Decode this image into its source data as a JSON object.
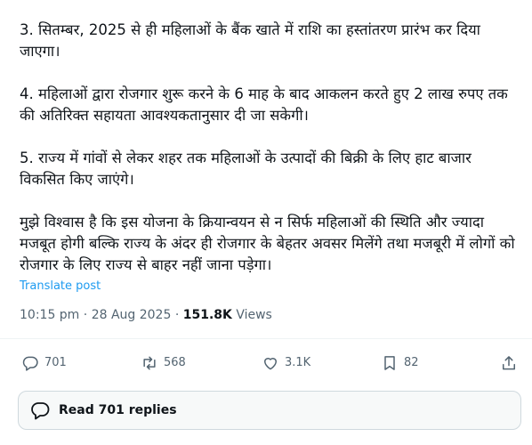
{
  "post": {
    "paragraphs": [
      "3. सितम्बर, 2025 से ही महिलाओं के बैंक खाते में राशि का हस्तांतरण प्रारंभ कर दिया जाएगा।",
      "4. महिलाओं द्वारा रोजगार शुरू करने के 6 माह के बाद आकलन करते हुए 2 लाख रुपए तक की अतिरिक्त सहायता आवश्यकतानुसार दी जा सकेगी।",
      "5. राज्य में गांवों से लेकर शहर तक महिलाओं के उत्पादों की बिक्री के लिए हाट बाजार विकसित किए जाएंगे।",
      "मुझे विश्वास है कि इस योजना के क्रियान्वयन से न सिर्फ महिलाओं की स्थिति और ज्यादा मजबूत होगी बल्कि राज्य के अंदर ही रोजगार के बेहतर अवसर मिलेंगे तथा मजबूरी में लोगों को रोजगार के लिए राज्य से बाहर नहीं जाना पड़ेगा।"
    ],
    "translate_label": "Translate post",
    "time": "10:15 pm",
    "separator": "·",
    "date": "28 Aug 2025",
    "views_count": "151.8K",
    "views_label": "Views"
  },
  "actions": {
    "replies": {
      "icon": "reply-icon",
      "count": "701"
    },
    "reposts": {
      "icon": "repost-icon",
      "count": "568"
    },
    "likes": {
      "icon": "heart-icon",
      "count": "3.1K"
    },
    "bookmarks": {
      "icon": "bookmark-icon",
      "count": "82"
    },
    "share": {
      "icon": "share-icon"
    }
  },
  "read_replies": {
    "icon": "speech-bubble-icon",
    "label": "Read 701 replies"
  },
  "colors": {
    "text": "#0f1419",
    "secondary": "#536471",
    "link": "#1d9bf0",
    "divider": "#eff3f4",
    "button_bg": "#f7f9f9",
    "button_border": "#cfd9de"
  }
}
